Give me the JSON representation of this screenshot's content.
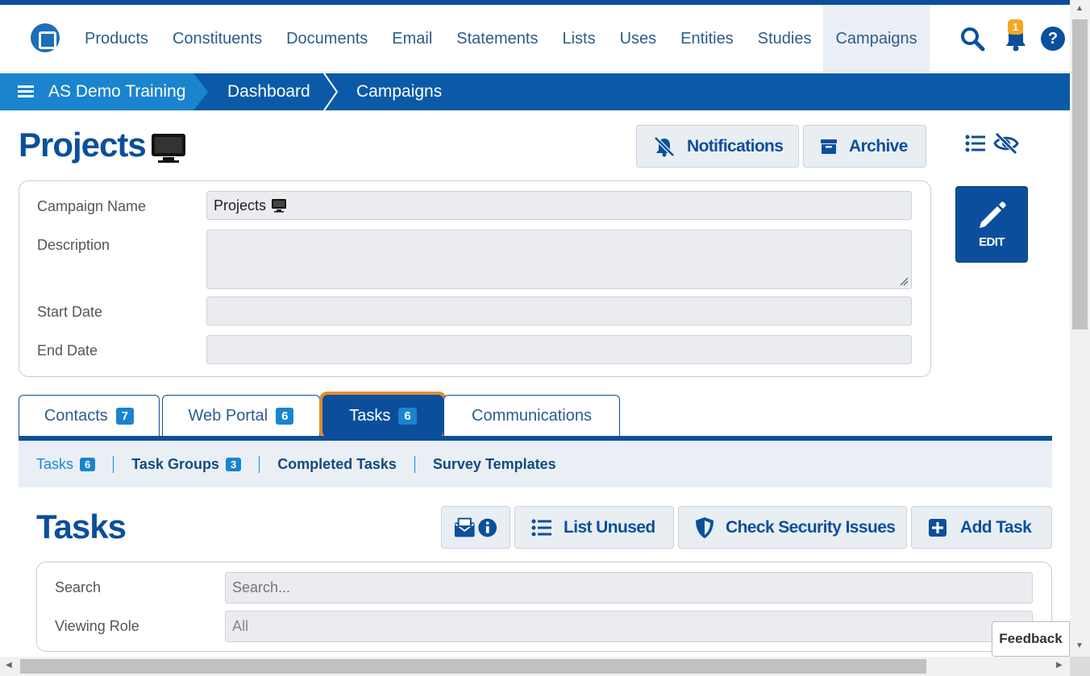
{
  "navbar": {
    "items": [
      "Products",
      "Constituents",
      "Documents",
      "Email",
      "Statements",
      "Lists",
      "Uses",
      "Entities",
      "Studies",
      "Campaigns"
    ],
    "active_item": "Campaigns",
    "notification_count": "1",
    "help_label": "?"
  },
  "breadcrumb": {
    "items": [
      "AS Demo Training",
      "Dashboard",
      "Campaigns"
    ]
  },
  "page": {
    "title": "Projects",
    "notifications_label": "Notifications",
    "archive_label": "Archive",
    "edit_label": "EDIT"
  },
  "form": {
    "campaign_name_label": "Campaign Name",
    "campaign_name_value": "Projects",
    "description_label": "Description",
    "start_date_label": "Start Date",
    "end_date_label": "End Date"
  },
  "tabs": [
    {
      "label": "Contacts",
      "count": "7"
    },
    {
      "label": "Web Portal",
      "count": "6"
    },
    {
      "label": "Tasks",
      "count": "6"
    },
    {
      "label": "Communications",
      "count": ""
    }
  ],
  "subtabs": [
    {
      "label": "Tasks",
      "count": "6"
    },
    {
      "label": "Task Groups",
      "count": "3"
    },
    {
      "label": "Completed Tasks",
      "count": ""
    },
    {
      "label": "Survey Templates",
      "count": ""
    }
  ],
  "tasks": {
    "title": "Tasks",
    "list_unused_label": "List Unused",
    "check_security_label": "Check Security Issues",
    "add_task_label": "Add Task"
  },
  "filters": {
    "search_label": "Search",
    "search_placeholder": "Search...",
    "viewing_role_label": "Viewing Role",
    "viewing_role_value": "All"
  },
  "feedback_label": "Feedback",
  "colors": {
    "primary": "#0b4f9c",
    "accent": "#1a84cf",
    "highlight": "#e58a2e",
    "badge": "#f5a623"
  }
}
